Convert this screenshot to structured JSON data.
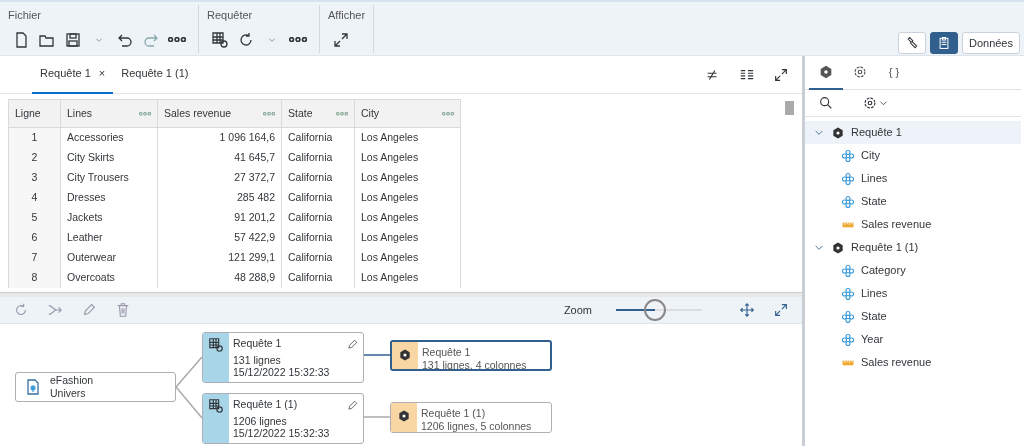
{
  "toolbar": {
    "groups": [
      {
        "label": "Fichier"
      },
      {
        "label": "Requêter"
      },
      {
        "label": "Afficher"
      }
    ],
    "right_buttons": [
      {
        "kind": "tool",
        "selected": false
      },
      {
        "kind": "clipboard",
        "selected": true
      },
      {
        "kind": "text",
        "label": "Données",
        "selected": false
      }
    ]
  },
  "query_tabs": [
    {
      "label": "Requête 1",
      "selected": true,
      "close": "×"
    },
    {
      "label": "Requête 1 (1)",
      "selected": false
    }
  ],
  "table": {
    "columns": [
      {
        "label": "Ligne",
        "menu": false
      },
      {
        "label": "Lines",
        "menu": true
      },
      {
        "label": "Sales revenue",
        "menu": true
      },
      {
        "label": "State",
        "menu": true
      },
      {
        "label": "City",
        "menu": true
      }
    ],
    "rows": [
      [
        "1",
        "Accessories",
        "1 096 164,6",
        "California",
        "Los Angeles"
      ],
      [
        "2",
        "City Skirts",
        "41 645,7",
        "California",
        "Los Angeles"
      ],
      [
        "3",
        "City Trousers",
        "27 372,7",
        "California",
        "Los Angeles"
      ],
      [
        "4",
        "Dresses",
        "285 482",
        "California",
        "Los Angeles"
      ],
      [
        "5",
        "Jackets",
        "91 201,2",
        "California",
        "Los Angeles"
      ],
      [
        "6",
        "Leather",
        "57 422,9",
        "California",
        "Los Angeles"
      ],
      [
        "7",
        "Outerwear",
        "121 299,1",
        "California",
        "Los Angeles"
      ],
      [
        "8",
        "Overcoats",
        "48 288,9",
        "California",
        "Los Angeles"
      ]
    ]
  },
  "diagram_toolbar": {
    "zoom_label": "Zoom",
    "level": 0.45
  },
  "diagram": {
    "source": {
      "name": "eFashion",
      "type": "Univers"
    },
    "queries": [
      {
        "name": "Requête 1",
        "rows": "131 lignes",
        "date": "15/12/2022 15:32:33",
        "result": {
          "name": "Requête 1",
          "summary": "131 lignes, 4 colonnes",
          "selected": true
        }
      },
      {
        "name": "Requête 1 (1)",
        "rows": "1206 lignes",
        "date": "15/12/2022 15:32:33",
        "result": {
          "name": "Requête 1 (1)",
          "summary": "1206 lignes, 5 colonnes",
          "selected": false
        }
      }
    ]
  },
  "side_tabs": [
    {
      "kind": "cube",
      "selected": true
    },
    {
      "kind": "gear",
      "selected": false
    },
    {
      "kind": "text",
      "label": "{ }",
      "selected": false
    }
  ],
  "tree": [
    {
      "label": "Requête 1",
      "expanded": true,
      "selected": true,
      "children": [
        {
          "label": "City",
          "kind": "dimension"
        },
        {
          "label": "Lines",
          "kind": "dimension"
        },
        {
          "label": "State",
          "kind": "dimension"
        },
        {
          "label": "Sales revenue",
          "kind": "measure"
        }
      ]
    },
    {
      "label": "Requête 1 (1)",
      "expanded": true,
      "selected": false,
      "children": [
        {
          "label": "Category",
          "kind": "dimension"
        },
        {
          "label": "Lines",
          "kind": "dimension"
        },
        {
          "label": "State",
          "kind": "dimension"
        },
        {
          "label": "Year",
          "kind": "dimension"
        },
        {
          "label": "Sales revenue",
          "kind": "measure"
        }
      ]
    }
  ]
}
